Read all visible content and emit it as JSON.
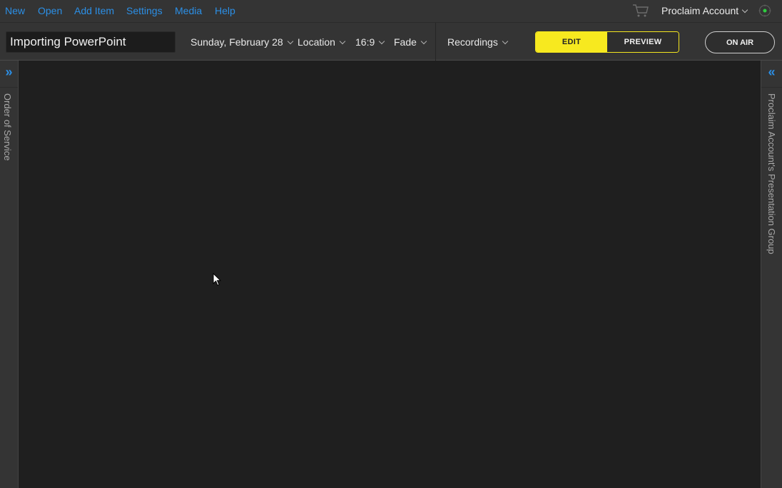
{
  "menu": {
    "new": "New",
    "open": "Open",
    "add_item": "Add Item",
    "settings": "Settings",
    "media": "Media",
    "help": "Help"
  },
  "account": {
    "label": "Proclaim Account",
    "cart_icon": "shopping-cart-icon",
    "status_icon": "status-indicator-icon"
  },
  "toolbar": {
    "presentation_title": "Importing PowerPoint",
    "date": "Sunday, February 28",
    "location": "Location",
    "aspect": "16:9",
    "transition": "Fade",
    "recordings": "Recordings",
    "edit": "EDIT",
    "preview": "PREVIEW",
    "on_air": "ON AIR"
  },
  "sidebars": {
    "left_label": "Order of Service",
    "left_expand": "»",
    "right_label": "Proclaim Account's Presentation Group",
    "right_expand": "«"
  },
  "colors": {
    "accent_blue": "#2b8fe6",
    "edit_yellow": "#f7e91f",
    "background": "#1f1f1f",
    "bar": "#343434"
  }
}
